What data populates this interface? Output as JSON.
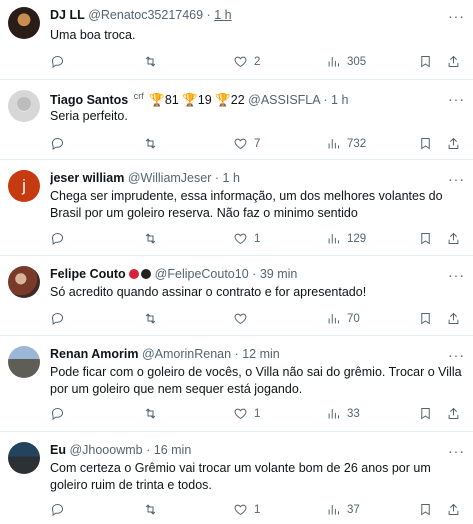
{
  "tweets": [
    {
      "name": "DJ LL",
      "handle": "@Renatoc35217469",
      "time": "1 h",
      "text": "Uma boa troca.",
      "replies": "",
      "retweets": "",
      "likes": "2",
      "views": "305"
    },
    {
      "name": "Tiago Santos",
      "badge": "crf",
      "trophies": [
        "81",
        "19",
        "22"
      ],
      "handle": "@ASSISFLA",
      "time": "1 h",
      "text": "Seria perfeito.",
      "replies": "",
      "retweets": "",
      "likes": "7",
      "views": "732"
    },
    {
      "name": "jeser william",
      "handle": "@WilliamJeser",
      "time": "1 h",
      "text": "Chega ser imprudente, essa informação, um dos melhores volantes do Brasil por um goleiro reserva. Não faz o minimo sentido",
      "replies": "",
      "retweets": "",
      "likes": "1",
      "views": "129"
    },
    {
      "name": "Felipe Couto",
      "handle": "@FelipeCouto10",
      "time": "39 min",
      "text": "Só acredito quando assinar o contrato e for apresentado!",
      "replies": "",
      "retweets": "",
      "likes": "",
      "views": "70"
    },
    {
      "name": "Renan Amorim",
      "handle": "@AmorinRenan",
      "time": "12 min",
      "text": "Pode ficar com o goleiro de vocês, o Villa não sai do grêmio. Trocar o Villa por um goleiro que nem sequer está jogando.",
      "replies": "",
      "retweets": "",
      "likes": "1",
      "views": "33"
    },
    {
      "name": "Eu",
      "handle": "@Jhooowmb",
      "time": "16 min",
      "text": "Com certeza o Grêmio vai trocar um volante bom de 26 anos por um goleiro ruim de trinta e todos.",
      "replies": "",
      "retweets": "",
      "likes": "1",
      "views": "37"
    }
  ],
  "separator": "·",
  "more_label": "···",
  "colors": {
    "text": "#0f1419",
    "muted": "#536471",
    "border": "#e6ecf0",
    "jeser_avatar": "#c63a10"
  }
}
